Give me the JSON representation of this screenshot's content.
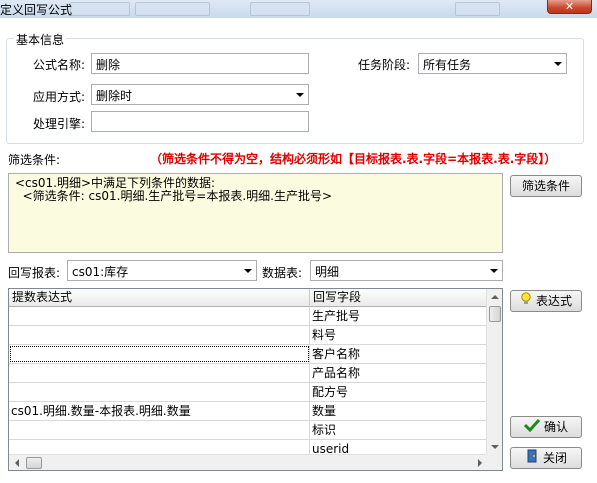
{
  "window": {
    "title": "定义回写公式",
    "close_glyph": "✕"
  },
  "basic_info": {
    "legend": "基本信息",
    "formula_name_label": "公式名称:",
    "formula_name_value": "删除",
    "task_stage_label": "任务阶段:",
    "task_stage_value": "所有任务",
    "apply_mode_label": "应用方式:",
    "apply_mode_value": "删除时",
    "handler_label": "处理引擎:",
    "handler_value": ""
  },
  "filter": {
    "label": "筛选条件:",
    "hint": "（筛选条件不得为空，结构必须形如【目标报表.表.字段=本报表.表.字段】）",
    "text": "<cs01.明细>中满足下列条件的数据:\n  <筛选条件: cs01.明细.生产批号=本报表.明细.生产批号>",
    "button_label": "筛选条件"
  },
  "writeback": {
    "report_label": "回写报表:",
    "report_value": "cs01:库存",
    "table_label": "数据表:",
    "table_value": "明细"
  },
  "grid": {
    "columns": [
      "提数表达式",
      "回写字段"
    ],
    "rows": [
      [
        "",
        "生产批号"
      ],
      [
        "",
        "料号"
      ],
      [
        "",
        "客户名称"
      ],
      [
        "",
        "产品名称"
      ],
      [
        "",
        "配方号"
      ],
      [
        "cs01.明细.数量-本报表.明细.数量",
        "数量"
      ],
      [
        "",
        "标识"
      ],
      [
        "",
        "userid"
      ]
    ]
  },
  "buttons": {
    "expression": "表达式",
    "confirm": "确认",
    "close": "关闭"
  },
  "colors": {
    "hint_red": "#e00000",
    "filter_bg": "#fbfbe0",
    "confirm_check": "#1a8a1a"
  },
  "icons": {
    "expression": "lightbulb-icon",
    "confirm": "checkmark-icon",
    "close": "door-exit-icon"
  }
}
